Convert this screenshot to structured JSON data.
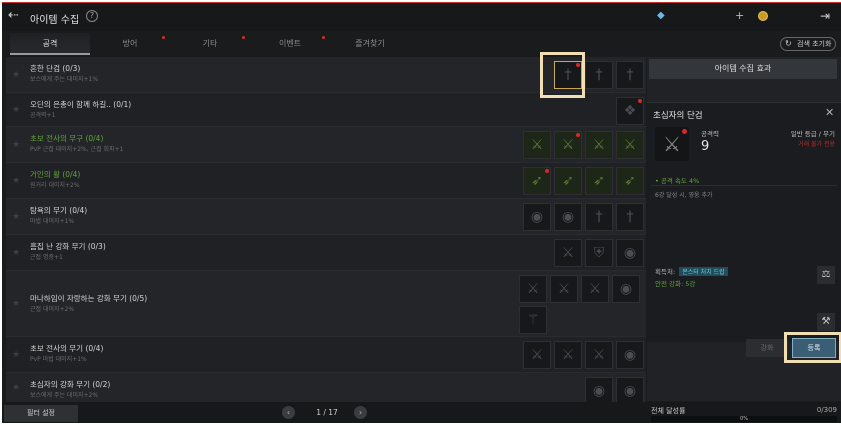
{
  "header": {
    "title": "아이템 수집",
    "help_icon": "?",
    "exit_icon": "exit-icon"
  },
  "tabs": [
    {
      "label": "공격",
      "active": true,
      "dot": false
    },
    {
      "label": "방어",
      "active": false,
      "dot": true
    },
    {
      "label": "기타",
      "active": false,
      "dot": true
    },
    {
      "label": "이벤트",
      "active": false,
      "dot": true
    },
    {
      "label": "즐겨찾기",
      "active": false,
      "dot": false
    }
  ],
  "reset_label": "검색 초기화",
  "rows": [
    {
      "name": "흔한 단검 (0/3)",
      "desc": "보스에게 주는 대미지+1%",
      "green": false,
      "slots": [
        "dagger",
        "dagger",
        "dagger"
      ],
      "sel": 0,
      "dots": [
        0
      ]
    },
    {
      "name": "오딘의 은총이 함께 하길.. (0/1)",
      "desc": "공격력+1",
      "green": false,
      "slots": [
        "tome"
      ],
      "sel": -1,
      "dots": [
        0
      ]
    },
    {
      "name": "초보 전사의 무구 (0/4)",
      "desc": "PvP 근접 대미지+2%, 근접 회피+1",
      "green": true,
      "slots": [
        "sword",
        "sword",
        "sword",
        "sword"
      ],
      "sel": -1,
      "dots": [
        1
      ]
    },
    {
      "name": "거인의 활 (0/4)",
      "desc": "원거리 대미지+2%",
      "green": true,
      "slots": [
        "bow",
        "bow",
        "bow",
        "bow"
      ],
      "sel": -1,
      "dots": [
        0
      ]
    },
    {
      "name": "탐욕의 무기 (0/4)",
      "desc": "마법 대미지+1%",
      "green": false,
      "slots": [
        "orb",
        "orb",
        "dagger",
        "dagger"
      ],
      "sel": -1,
      "dots": []
    },
    {
      "name": "흠집 난 강화 무기 (0/3)",
      "desc": "근접 명중+1",
      "green": false,
      "slots": [
        "sword",
        "shield",
        "orb"
      ],
      "sel": -1,
      "dots": []
    },
    {
      "name": "마나하임이 자랑하는 강화 무기 (0/5)",
      "desc": "근접 대미지+2%",
      "green": false,
      "slots": [
        "sword",
        "sword",
        "sword",
        "orb",
        "staff"
      ],
      "sel": -1,
      "dots": []
    },
    {
      "name": "초보 전사의 무기 (0/4)",
      "desc": "PvP 마법 대미지+1%",
      "green": false,
      "slots": [
        "sword",
        "sword",
        "sword",
        "orb"
      ],
      "sel": -1,
      "dots": []
    },
    {
      "name": "초심자의 강화 무기 (0/2)",
      "desc": "보스에게 주는 대미지+2%",
      "green": false,
      "slots": [
        "orb",
        "orb"
      ],
      "sel": -1,
      "dots": []
    }
  ],
  "filter_label": "필터 설정",
  "pager": {
    "text": "1 / 17"
  },
  "panel": {
    "header": "아이템 수집 효과",
    "item_title": "초심자의 단검",
    "atk_label": "공격력",
    "atk_value": "9",
    "grade": "일반 등급 / 무기",
    "warn": "거래 불가 전용",
    "stat": "• 공격 속도 4%",
    "note": "6강 달성 시, 영웅 추가",
    "acq_label": "획득처:",
    "acq_tag": "몬스터 처치 드랍",
    "safe": "안전 강화: 5강",
    "enhance": "강화",
    "register": "등록"
  },
  "progress": {
    "label": "전체 달성률",
    "count": "0/309",
    "pct": "0%",
    "value": 0
  },
  "colors": {
    "accent": "#3c5e74",
    "highlight": "#f1dfb3",
    "green": "#5fa53a",
    "red_dot": "#d42a2a"
  }
}
